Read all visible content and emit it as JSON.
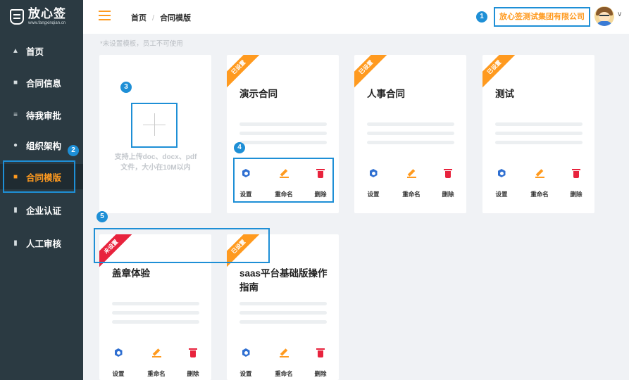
{
  "sidebar": {
    "logo_title": "放心签",
    "logo_sub": "www.fangxinqian.cn",
    "items": [
      {
        "label": "首页",
        "icon": "home-icon"
      },
      {
        "label": "合同信息",
        "icon": "book-icon"
      },
      {
        "label": "待我审批",
        "icon": "list-icon"
      },
      {
        "label": "组织架构",
        "icon": "user-icon"
      },
      {
        "label": "合同模版",
        "icon": "template-icon",
        "active": true
      },
      {
        "label": "企业认证",
        "icon": "document-icon"
      },
      {
        "label": "人工审核",
        "icon": "document-icon"
      }
    ]
  },
  "header": {
    "breadcrumb_home": "首页",
    "breadcrumb_sep": "/",
    "breadcrumb_current": "合同模版",
    "company": "放心签测试集团有限公司"
  },
  "notice": "*未设置模板，员工不可使用",
  "upload": {
    "text": "支持上传doc、docx、pdf文件，大小在10M以内"
  },
  "actions": {
    "settings": "设置",
    "rename": "重命名",
    "delete": "删除"
  },
  "templates": [
    {
      "title": "演示合同",
      "status": "已设置"
    },
    {
      "title": "人事合同",
      "status": "已设置"
    },
    {
      "title": "测试",
      "status": "已设置"
    },
    {
      "title": "盖章体验",
      "status": "未设置"
    },
    {
      "title": "saas平台基础版操作指南",
      "status": "已设置"
    }
  ],
  "callouts": [
    "1",
    "2",
    "3",
    "4",
    "5"
  ],
  "colors": {
    "accent": "#ff9a1f",
    "sidebar": "#2b3a42",
    "highlight": "#1e8fd6",
    "danger": "#e8233d"
  }
}
